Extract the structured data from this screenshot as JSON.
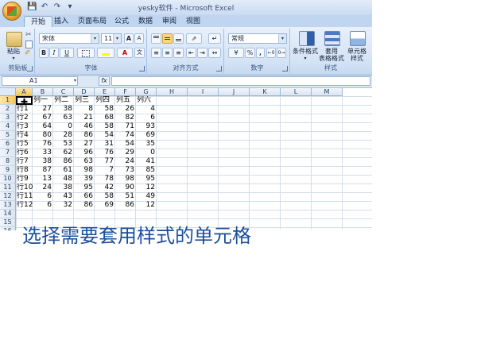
{
  "window": {
    "title": "yesky软件 - Microsoft Excel"
  },
  "qat": {
    "save_icon": "save-icon",
    "undo_icon": "undo-icon",
    "redo_icon": "redo-icon"
  },
  "tabs": [
    "开始",
    "插入",
    "页面布局",
    "公式",
    "数据",
    "审阅",
    "视图"
  ],
  "ribbon": {
    "clipboard": {
      "paste": "粘贴",
      "label": "剪贴板"
    },
    "font": {
      "name": "宋体",
      "size": "11",
      "bold": "B",
      "italic": "I",
      "underline": "U",
      "grow": "A",
      "shrink": "A",
      "color_letter": "A",
      "label": "字体"
    },
    "alignment": {
      "label": "对齐方式"
    },
    "number": {
      "format": "常规",
      "percent": "%",
      "comma": ",",
      "label": "数字"
    },
    "styles": {
      "conditional": "条件格式",
      "table_format_1": "套用",
      "table_format_2": "表格格式",
      "cell_styles_1": "单元格",
      "cell_styles_2": "样式",
      "label": "样式"
    }
  },
  "formula_bar": {
    "name_box": "A1",
    "fx": "fx",
    "value": ""
  },
  "columns": [
    "A",
    "B",
    "C",
    "D",
    "E",
    "F",
    "G",
    "H",
    "I",
    "J",
    "K",
    "L",
    "M"
  ],
  "rows": [
    "1",
    "2",
    "3",
    "4",
    "5",
    "6",
    "7",
    "8",
    "9",
    "10",
    "11",
    "12",
    "13",
    "14",
    "15",
    "16"
  ],
  "sheet": {
    "headers": [
      "",
      "列一",
      "列二",
      "列三",
      "列四",
      "列五",
      "列六"
    ],
    "data": [
      [
        "行1",
        "27",
        "38",
        "8",
        "58",
        "26",
        "4"
      ],
      [
        "行2",
        "67",
        "63",
        "21",
        "68",
        "82",
        "6"
      ],
      [
        "行3",
        "64",
        "0",
        "46",
        "58",
        "71",
        "93"
      ],
      [
        "行4",
        "80",
        "28",
        "86",
        "54",
        "74",
        "69"
      ],
      [
        "行5",
        "76",
        "53",
        "27",
        "31",
        "54",
        "35"
      ],
      [
        "行6",
        "33",
        "62",
        "96",
        "76",
        "29",
        "0"
      ],
      [
        "行7",
        "38",
        "86",
        "63",
        "77",
        "24",
        "41"
      ],
      [
        "行8",
        "87",
        "61",
        "98",
        "7",
        "73",
        "85"
      ],
      [
        "行9",
        "13",
        "48",
        "39",
        "78",
        "98",
        "95"
      ],
      [
        "行10",
        "24",
        "38",
        "95",
        "42",
        "90",
        "12"
      ],
      [
        "行11",
        "6",
        "43",
        "66",
        "58",
        "51",
        "49"
      ],
      [
        "行12",
        "6",
        "32",
        "86",
        "69",
        "86",
        "12"
      ]
    ]
  },
  "caption": "选择需要套用样式的单元格",
  "colors": {
    "caption": "#1b4f9c",
    "ribbon": "#d3e2f5",
    "active_header": "#f7c75e"
  }
}
